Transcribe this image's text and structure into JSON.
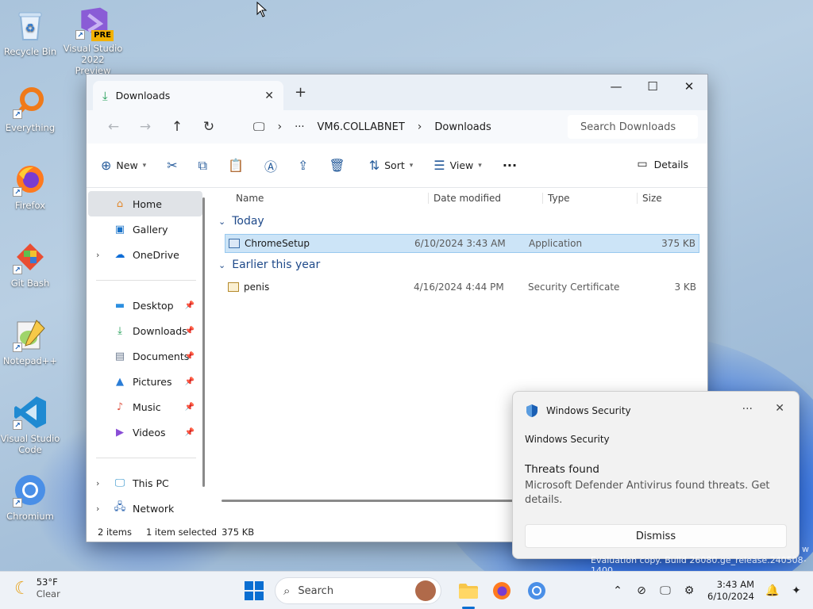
{
  "desktop": {
    "icons": [
      {
        "label": "Recycle Bin",
        "icon": "recycle-bin-icon"
      },
      {
        "label": "Visual Studio 2022 Preview",
        "badge": "PRE",
        "icon": "visual-studio-icon"
      },
      {
        "label": "Everything",
        "icon": "everything-search-icon"
      },
      {
        "label": "Firefox",
        "icon": "firefox-icon"
      },
      {
        "label": "Git Bash",
        "icon": "git-bash-icon"
      },
      {
        "label": "Notepad++",
        "icon": "notepad-plus-plus-icon"
      },
      {
        "label": "Visual Studio Code",
        "icon": "vscode-icon"
      },
      {
        "label": "Chromium",
        "icon": "chromium-icon"
      }
    ],
    "watermark": "Evaluation copy. Build 26080.ge_release.240508-1400",
    "watermark_edge": "w"
  },
  "explorer": {
    "tab_title": "Downloads",
    "new_tab": "+",
    "breadcrumb": {
      "more": "···",
      "root": "VM6.COLLABNET",
      "current": "Downloads"
    },
    "search_placeholder": "Search Downloads",
    "commands": {
      "new": "New",
      "sort": "Sort",
      "view": "View",
      "more": "···",
      "details": "Details"
    },
    "sidebar": {
      "top": [
        {
          "label": "Home",
          "icon": "home-icon",
          "selected": true
        },
        {
          "label": "Gallery",
          "icon": "gallery-icon"
        },
        {
          "label": "OneDrive",
          "icon": "onedrive-icon",
          "expandable": true
        }
      ],
      "pinned": [
        {
          "label": "Desktop",
          "icon": "desktop-folder-icon"
        },
        {
          "label": "Downloads",
          "icon": "downloads-folder-icon"
        },
        {
          "label": "Documents",
          "icon": "documents-folder-icon"
        },
        {
          "label": "Pictures",
          "icon": "pictures-folder-icon"
        },
        {
          "label": "Music",
          "icon": "music-folder-icon"
        },
        {
          "label": "Videos",
          "icon": "videos-folder-icon"
        }
      ],
      "bottom": [
        {
          "label": "This PC",
          "icon": "this-pc-icon",
          "expandable": true
        },
        {
          "label": "Network",
          "icon": "network-icon",
          "expandable": true
        }
      ]
    },
    "columns": {
      "name": "Name",
      "date": "Date modified",
      "type": "Type",
      "size": "Size"
    },
    "groups": [
      {
        "label": "Today",
        "files": [
          {
            "name": "ChromeSetup",
            "date": "6/10/2024 3:43 AM",
            "type": "Application",
            "size": "375 KB",
            "selected": true
          }
        ]
      },
      {
        "label": "Earlier this year",
        "files": [
          {
            "name": "penis",
            "date": "4/16/2024 4:44 PM",
            "type": "Security Certificate",
            "size": "3 KB"
          }
        ]
      }
    ],
    "status": {
      "count": "2 items",
      "selection": "1 item selected",
      "size": "375 KB"
    }
  },
  "toast": {
    "app_name": "Windows Security",
    "source": "Windows Security",
    "title": "Threats found",
    "message": "Microsoft Defender Antivirus found threats. Get details.",
    "dismiss": "Dismiss",
    "more": "···"
  },
  "taskbar": {
    "weather": {
      "temp": "53°F",
      "condition": "Clear"
    },
    "search_label": "Search",
    "clock": {
      "time": "3:43 AM",
      "date": "6/10/2024"
    },
    "accent": "#0a6ed1"
  }
}
